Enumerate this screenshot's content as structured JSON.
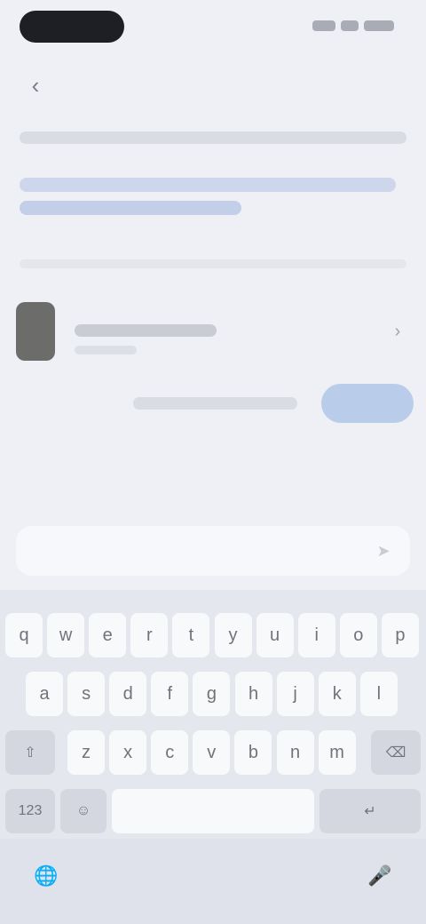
{
  "status_bar": {
    "time": ""
  },
  "header": {
    "back_glyph": "‹",
    "title": ""
  },
  "info": {
    "text": ""
  },
  "app_row": {
    "name": "",
    "subtitle": "",
    "chevron": "›"
  },
  "actions": {
    "secondary_label": "",
    "primary_label": ""
  },
  "composer": {
    "placeholder": "",
    "send_glyph": "➤"
  },
  "keyboard": {
    "row1": [
      "q",
      "w",
      "e",
      "r",
      "t",
      "y",
      "u",
      "i",
      "o",
      "p"
    ],
    "row2": [
      "a",
      "s",
      "d",
      "f",
      "g",
      "h",
      "j",
      "k",
      "l"
    ],
    "row3": [
      "z",
      "x",
      "c",
      "v",
      "b",
      "n",
      "m"
    ],
    "shift": "⇧",
    "backspace": "⌫",
    "numbers": "123",
    "emoji": "☺",
    "space": "",
    "return": "↵",
    "globe": "🌐",
    "mic": "🎤"
  },
  "colors": {
    "accent": "#b9cdea",
    "background": "#eef0f5",
    "keyboard": "#e4e7ee"
  }
}
